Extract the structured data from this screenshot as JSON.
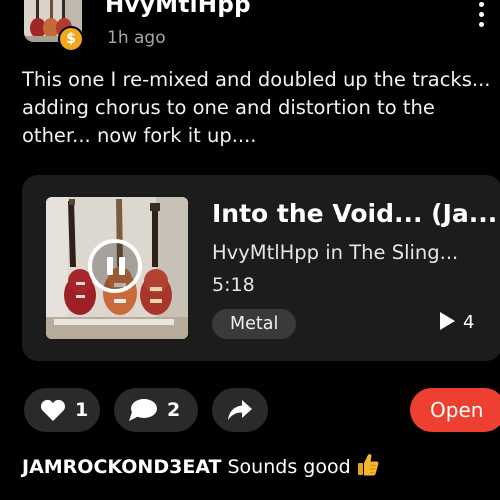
{
  "post": {
    "username": "HvyMtlHpp",
    "time_ago": "1h ago",
    "badge_icon": "dollar-coin-icon",
    "text": "This one I re-mixed and  doubled up the tracks... adding chorus to one and distortion to the other... now fork it up...."
  },
  "track": {
    "title": "Into the Void... (Ja...",
    "artist": "HvyMtlHpp in The Sling...",
    "duration": "5:18",
    "genre": "Metal",
    "plays": "4"
  },
  "actions": {
    "likes": "1",
    "comments": "2",
    "open_label": "Open"
  },
  "comment": {
    "user": "JAMROCKOND3EAT",
    "text": "Sounds good",
    "emoji_icon": "thumbs-up-icon"
  },
  "colors": {
    "accent": "#ee4031",
    "card": "#1c1c1c",
    "pill": "#2a2a2a",
    "muted": "#a6a6a6"
  }
}
